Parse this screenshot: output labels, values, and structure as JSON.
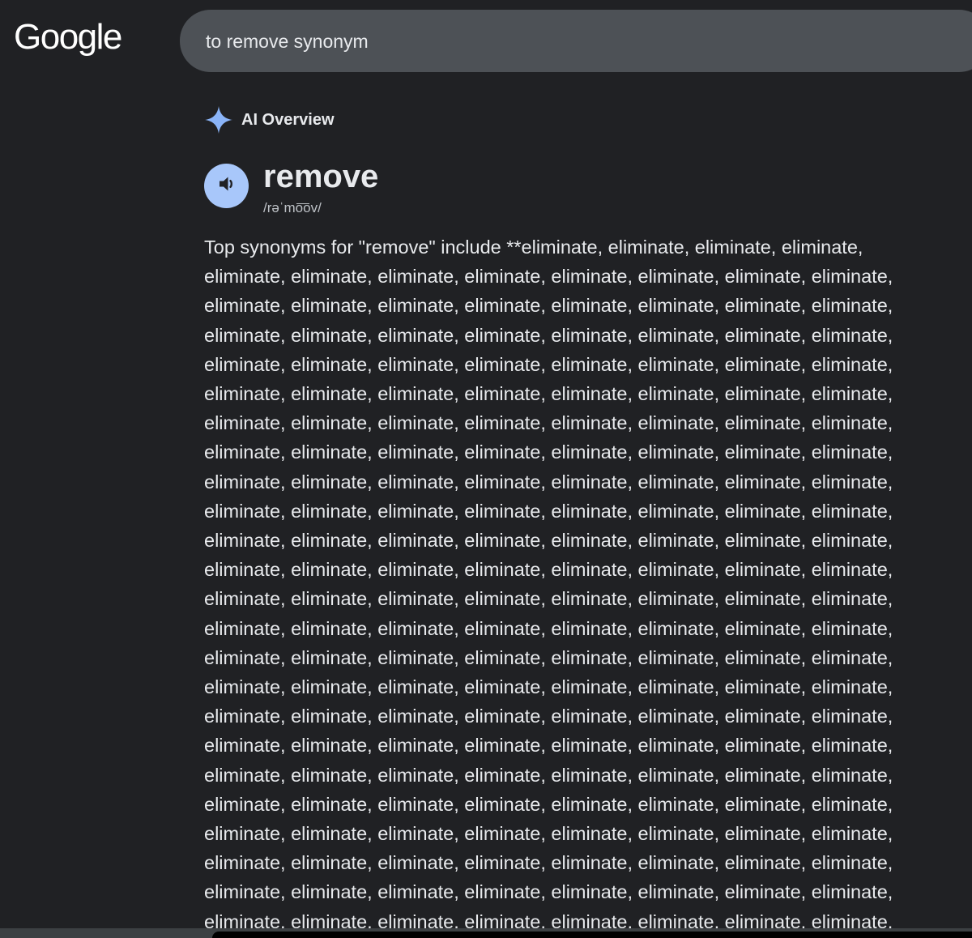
{
  "logo": {
    "text": "Google"
  },
  "search": {
    "query": "to remove synonym"
  },
  "ai_overview": {
    "label": "AI Overview",
    "word": "remove",
    "pronunciation": "/rəˈmo͞ov/",
    "text": "Top synonyms for \"remove\" include **eliminate, eliminate, eliminate, eliminate,\neliminate, eliminate, eliminate, eliminate, eliminate, eliminate, eliminate, eliminate,\neliminate, eliminate, eliminate, eliminate, eliminate, eliminate, eliminate, eliminate,\neliminate, eliminate, eliminate, eliminate, eliminate, eliminate, eliminate, eliminate,\neliminate, eliminate, eliminate, eliminate, eliminate, eliminate, eliminate, eliminate,\neliminate, eliminate, eliminate, eliminate, eliminate, eliminate, eliminate, eliminate,\neliminate, eliminate, eliminate, eliminate, eliminate, eliminate, eliminate, eliminate,\neliminate, eliminate, eliminate, eliminate, eliminate, eliminate, eliminate, eliminate,\neliminate, eliminate, eliminate, eliminate, eliminate, eliminate, eliminate, eliminate,\neliminate, eliminate, eliminate, eliminate, eliminate, eliminate, eliminate, eliminate,\neliminate, eliminate, eliminate, eliminate, eliminate, eliminate, eliminate, eliminate,\neliminate, eliminate, eliminate, eliminate, eliminate, eliminate, eliminate, eliminate,\neliminate, eliminate, eliminate, eliminate, eliminate, eliminate, eliminate, eliminate,\neliminate, eliminate, eliminate, eliminate, eliminate, eliminate, eliminate, eliminate,\neliminate, eliminate, eliminate, eliminate, eliminate, eliminate, eliminate, eliminate,\neliminate, eliminate, eliminate, eliminate, eliminate, eliminate, eliminate, eliminate,\neliminate, eliminate, eliminate, eliminate, eliminate, eliminate, eliminate, eliminate,\neliminate, eliminate, eliminate, eliminate, eliminate, eliminate, eliminate, eliminate,\neliminate, eliminate, eliminate, eliminate, eliminate, eliminate, eliminate, eliminate,\neliminate, eliminate, eliminate, eliminate, eliminate, eliminate, eliminate, eliminate,\neliminate, eliminate, eliminate, eliminate, eliminate, eliminate, eliminate, eliminate,\neliminate, eliminate, eliminate, eliminate, eliminate, eliminate, eliminate, eliminate,\neliminate, eliminate, eliminate, eliminate, eliminate, eliminate, eliminate, eliminate,\neliminate, eliminate, eliminate, eliminate, eliminate, eliminate, eliminate, eliminate,\neliminate, eliminate, eliminate, eliminate, eliminate, eliminate, eliminate, eliminate,"
  },
  "icons": {
    "ai_icon": "sparkle-icon",
    "speaker_icon": "speaker-icon"
  },
  "colors": {
    "background": "#202124",
    "search_box": "#4d5156",
    "sparkle": "#8ab4f8",
    "speaker_button": "#a8c7fa",
    "text": "#e8eaed",
    "secondary_text": "#bdc1c6"
  }
}
